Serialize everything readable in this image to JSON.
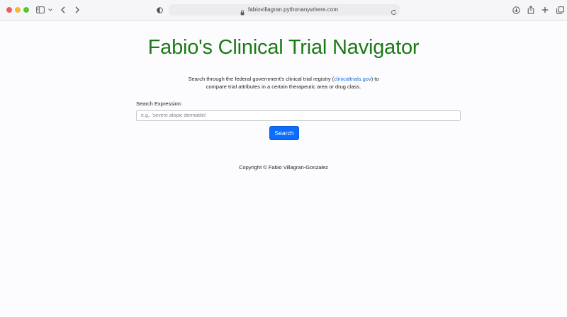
{
  "browser": {
    "url": "fabiovillagran.pythonanywhere.com",
    "icons": {
      "sidebar": "sidebar-icon",
      "chevron": "chevron-down-icon",
      "back": "back-arrow-icon",
      "forward": "forward-arrow-icon",
      "privacy": "privacy-shield-icon",
      "lock": "lock-icon",
      "reload": "reload-icon",
      "download": "download-icon",
      "share": "share-icon",
      "new_tab": "plus-icon",
      "tabs": "tab-overview-icon"
    }
  },
  "page": {
    "title": "Fabio's Clinical Trial Navigator",
    "intro_before_link": "Search through the federal government's clinical trial registry (",
    "intro_link": "clinicaltrials.gov",
    "intro_after_link": ") to compare trial attributes in a certain therapeutic area or drug class.",
    "search": {
      "label": "Search Expression:",
      "value": "",
      "placeholder": "e.g., 'severe atopic dermatitis'",
      "button_label": "Search"
    },
    "footer": "Copyright © Fabio Villagran-Gonzalez"
  },
  "colors": {
    "title": "#1c7a16",
    "link": "#1567e0",
    "button": "#0d6efd",
    "background": "#fcfcfe"
  }
}
